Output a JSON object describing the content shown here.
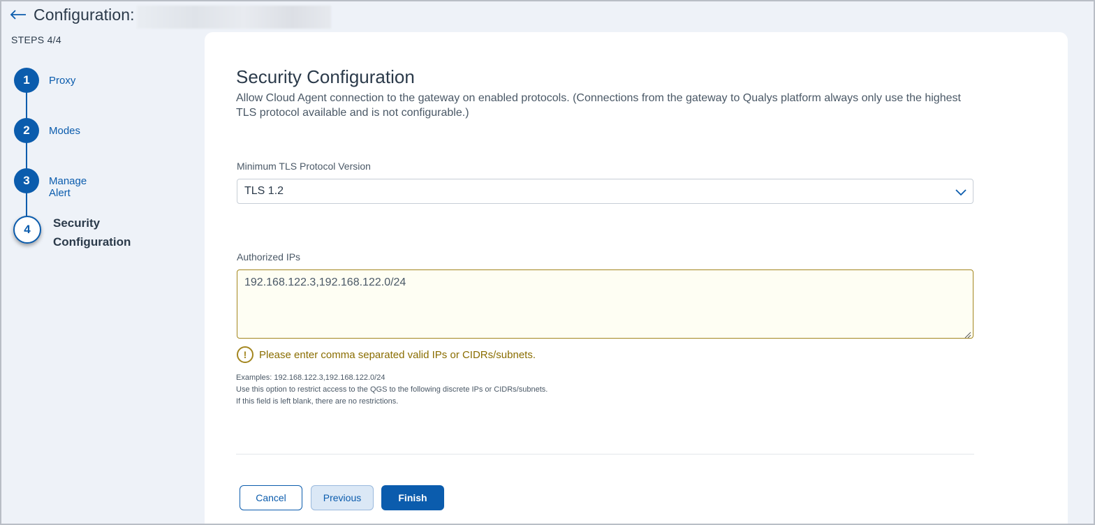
{
  "header": {
    "title": "Configuration:",
    "back_icon": "arrow-left-icon"
  },
  "stepper": {
    "count_label": "STEPS 4/4",
    "steps": [
      {
        "number": "1",
        "label": "Proxy",
        "state": "completed"
      },
      {
        "number": "2",
        "label": "Modes",
        "state": "completed"
      },
      {
        "number": "3",
        "label": "Manage Alert",
        "state": "completed"
      },
      {
        "number": "4",
        "label_line1": "Security",
        "label_line2": "Configuration",
        "state": "active"
      }
    ]
  },
  "main": {
    "title": "Security Configuration",
    "description": "Allow Cloud Agent connection to the gateway on enabled protocols. (Connections from the gateway to Qualys platform always only use the highest TLS protocol available and is not configurable.)",
    "tls": {
      "label": "Minimum TLS Protocol Version",
      "selected": "TLS 1.2"
    },
    "ips": {
      "label": "Authorized IPs",
      "value": "192.168.122.3,192.168.122.0/24",
      "warning": "Please enter comma separated valid IPs or CIDRs/subnets.",
      "help": [
        "Examples: 192.168.122.3,192.168.122.0/24",
        "Use this option to restrict access to the QGS to the following discrete IPs or CIDRs/subnets.",
        "If this field is left blank, there are no restrictions."
      ]
    }
  },
  "footer": {
    "cancel_label": "Cancel",
    "previous_label": "Previous",
    "finish_label": "Finish"
  },
  "colors": {
    "primary": "#0b5cad",
    "warning": "#a3861f",
    "background": "#eef2f8"
  }
}
